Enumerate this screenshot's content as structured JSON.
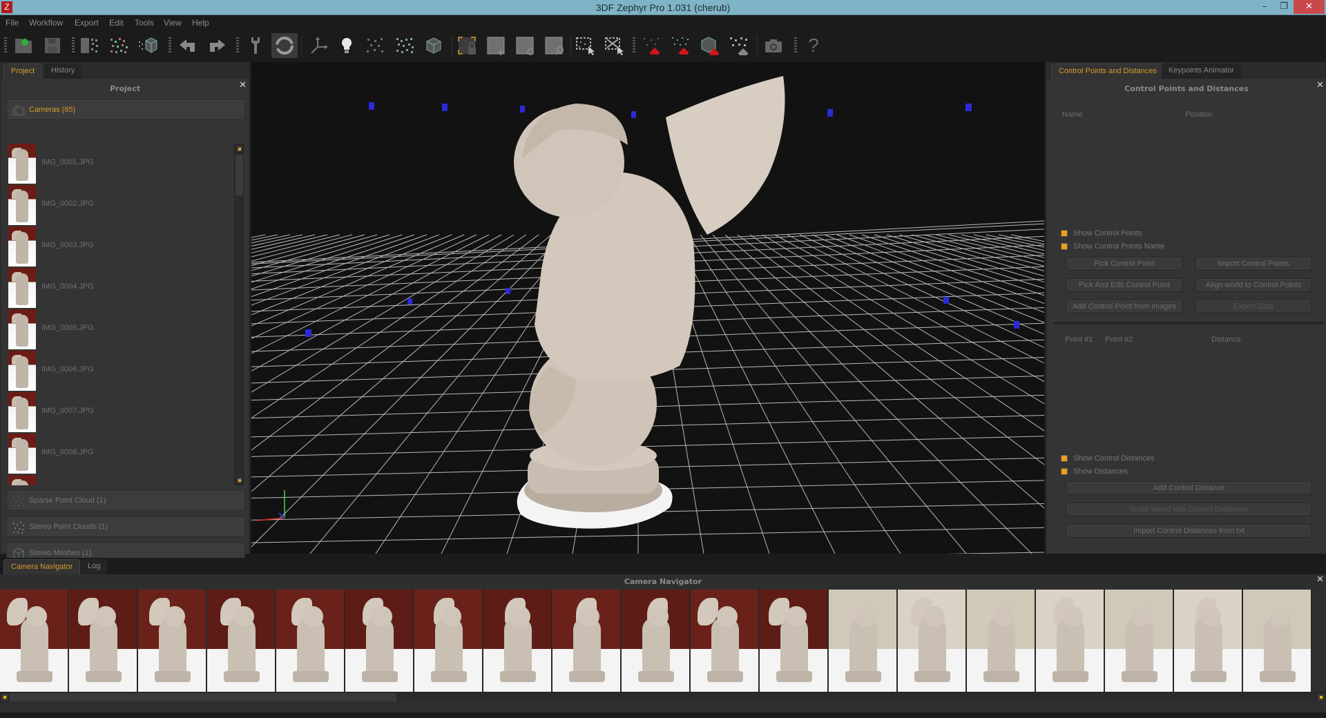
{
  "window": {
    "title": "3DF Zephyr Pro 1.031 (cherub)",
    "app_icon_letter": "Z",
    "controls": {
      "minimize": "–",
      "maximize": "❐",
      "close": "✕"
    }
  },
  "menu": [
    "File",
    "Workflow",
    "Export",
    "Edit",
    "Tools",
    "View",
    "Help"
  ],
  "toolbar": {
    "buttons": [
      {
        "name": "new-project-icon"
      },
      {
        "name": "save-project-icon"
      },
      {
        "name": "sparse-reconstruction-icon"
      },
      {
        "name": "dense-reconstruction-icon"
      },
      {
        "name": "mesh-reconstruction-icon"
      },
      {
        "name": "undo-icon"
      },
      {
        "name": "redo-icon"
      },
      {
        "name": "tools-wrench-icon"
      },
      {
        "name": "orbit-rotate-icon",
        "active": true
      },
      {
        "name": "axis-gizmo-icon"
      },
      {
        "name": "lighting-bulb-icon"
      },
      {
        "name": "show-sparse-cloud-icon"
      },
      {
        "name": "show-dense-cloud-icon"
      },
      {
        "name": "show-mesh-icon"
      },
      {
        "name": "bounding-box-lock-icon"
      },
      {
        "name": "bounding-box-move-icon"
      },
      {
        "name": "bounding-box-rotate-icon"
      },
      {
        "name": "bounding-box-scale-icon"
      },
      {
        "name": "select-points-icon"
      },
      {
        "name": "deselect-points-icon"
      },
      {
        "name": "filter-sparse-icon"
      },
      {
        "name": "filter-dense-icon"
      },
      {
        "name": "filter-mesh-icon"
      },
      {
        "name": "filter-selection-icon"
      },
      {
        "name": "screenshot-camera-icon"
      },
      {
        "name": "help-icon",
        "glyph": "?"
      }
    ]
  },
  "left_panel": {
    "tabs": [
      {
        "label": "Project",
        "active": true
      },
      {
        "label": "History",
        "active": false
      }
    ],
    "header": "Project",
    "close": "✕",
    "cameras_section": {
      "label": "Cameras (65)"
    },
    "cameras": [
      "IMG_0001.JPG",
      "IMG_0002.JPG",
      "IMG_0003.JPG",
      "IMG_0004.JPG",
      "IMG_0005.JPG",
      "IMG_0006.JPG",
      "IMG_0007.JPG",
      "IMG_0008.JPG"
    ],
    "sections": [
      {
        "label": "Sparse Point Cloud (1)"
      },
      {
        "label": "Stereo Point Clouds (1)"
      },
      {
        "label": "Stereo Meshes (1)"
      }
    ]
  },
  "right_panel": {
    "tabs": [
      {
        "label": "Control Points and Distances",
        "active": true
      },
      {
        "label": "Keypoints Animator",
        "active": false
      }
    ],
    "header": "Control Points and Distances",
    "close": "✕",
    "points_table": {
      "columns": [
        "Name",
        "Position"
      ],
      "rows": []
    },
    "point_checkboxes": [
      {
        "label": "Show Control Points",
        "checked": true
      },
      {
        "label": "Show Control Points Name",
        "checked": true
      }
    ],
    "point_buttons": [
      "Pick Control Point",
      "Import Control Points",
      "Pick And Edit Control Point",
      "Align world to Control Points",
      "Add Control Point from images",
      "Export Data"
    ],
    "distances_table": {
      "columns": [
        "Point #1",
        "Point #2",
        "Distance"
      ],
      "rows": []
    },
    "distance_checkboxes": [
      {
        "label": "Show Control Distances",
        "checked": true
      },
      {
        "label": "Show Distances",
        "checked": true
      }
    ],
    "distance_buttons": [
      "Add Control Distance",
      "Scale World with Control Distances",
      "Import Control Distances from txt"
    ]
  },
  "bottom_panel": {
    "tabs": [
      {
        "label": "Camera Navigator",
        "active": true
      },
      {
        "label": "Log",
        "active": false
      }
    ],
    "header": "Camera Navigator",
    "close": "✕",
    "frames_visible": 19
  },
  "colors": {
    "accent": "#d89b2a",
    "checkbox": "#f19c1d",
    "titlebar": "#7fb4c6",
    "close_button": "#c9494b"
  }
}
